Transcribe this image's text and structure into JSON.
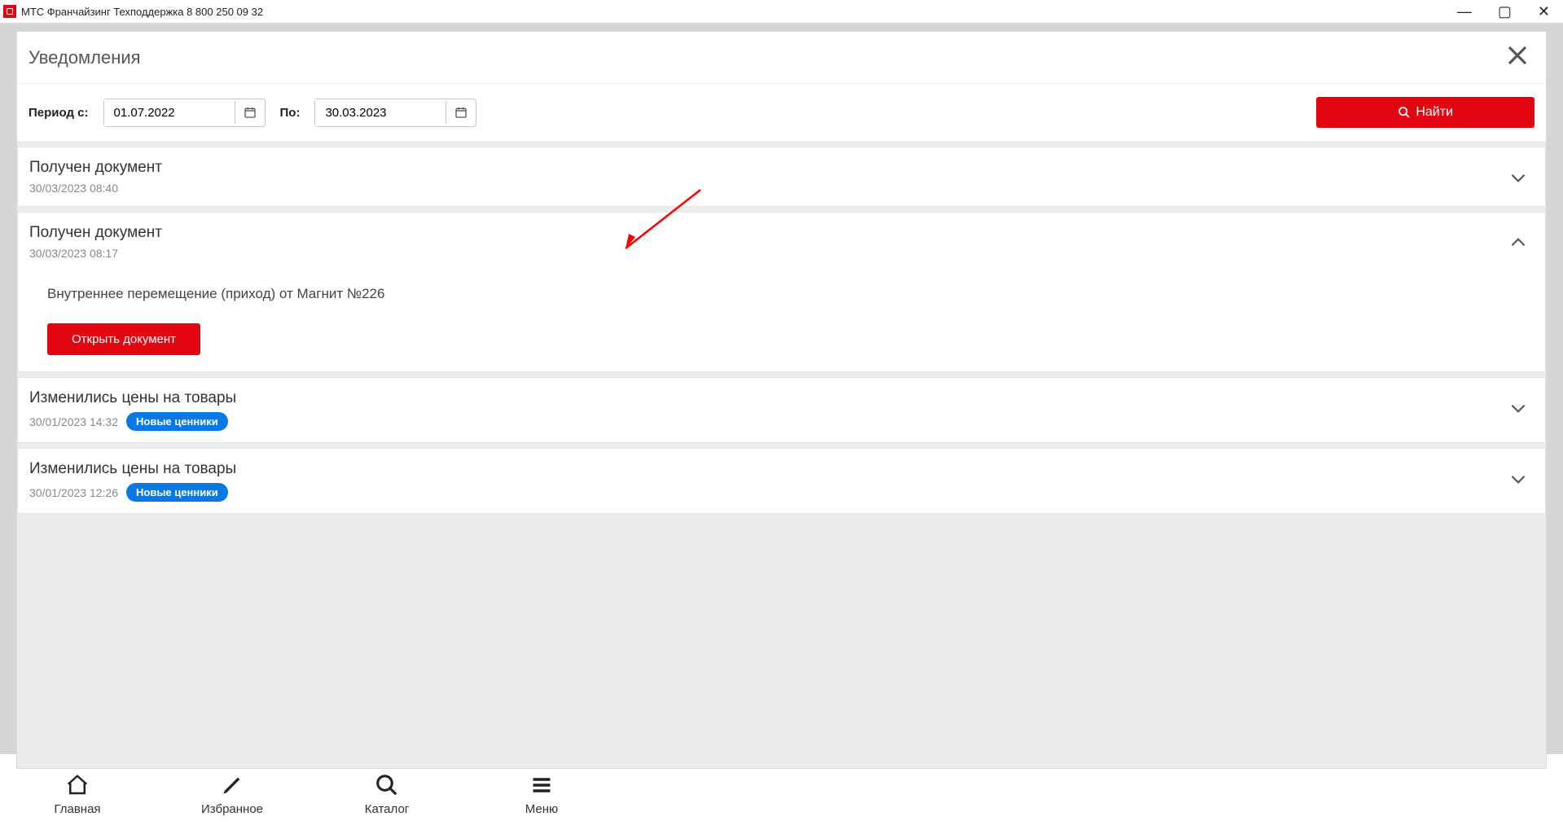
{
  "window": {
    "title": "МТС Франчайзинг Техподдержка 8 800 250 09 32"
  },
  "modal": {
    "title": "Уведомления",
    "period_from_label": "Период с:",
    "period_to_label": "По:",
    "date_from": "01.07.2022",
    "date_to": "30.03.2023",
    "find_label": "Найти"
  },
  "notifications": [
    {
      "title": "Получен документ",
      "date": "30/03/2023 08:40",
      "expanded": false,
      "badge": null
    },
    {
      "title": "Получен документ",
      "date": "30/03/2023 08:17",
      "expanded": true,
      "badge": null,
      "body_text": "Внутреннее перемещение (приход) от Магнит №226",
      "open_label": "Открыть документ"
    },
    {
      "title": "Изменились цены на товары",
      "date": "30/01/2023 14:32",
      "expanded": false,
      "badge": "Новые ценники"
    },
    {
      "title": "Изменились цены на товары",
      "date": "30/01/2023 12:26",
      "expanded": false,
      "badge": "Новые ценники"
    }
  ],
  "nav": [
    {
      "label": "Главная",
      "icon": "home-icon"
    },
    {
      "label": "Избранное",
      "icon": "pencil-icon"
    },
    {
      "label": "Каталог",
      "icon": "search-icon"
    },
    {
      "label": "Меню",
      "icon": "menu-icon"
    }
  ]
}
